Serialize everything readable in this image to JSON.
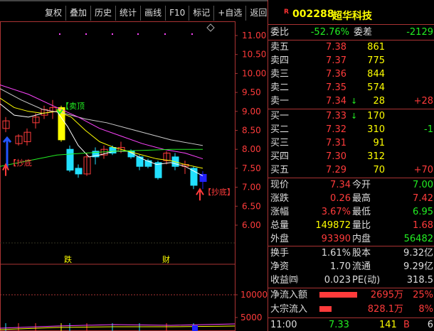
{
  "toolbar": {
    "items": [
      "复权",
      "叠加",
      "历史",
      "统计",
      "画线",
      "F10",
      "标记",
      "+自选",
      "返回"
    ]
  },
  "stock": {
    "badge": "R",
    "code": "002288",
    "name": "超华科技"
  },
  "quote": {
    "weibi_label": "委比",
    "weibi_value": "-52.76%",
    "weicha_label": "委差",
    "weicha_value": "-2129",
    "sells": [
      {
        "label": "卖五",
        "price": "7.38",
        "vol": "861",
        "chg": ""
      },
      {
        "label": "卖四",
        "price": "7.37",
        "vol": "775",
        "chg": ""
      },
      {
        "label": "卖三",
        "price": "7.36",
        "vol": "844",
        "chg": ""
      },
      {
        "label": "卖二",
        "price": "7.35",
        "vol": "574",
        "chg": ""
      },
      {
        "label": "卖一",
        "price": "7.34",
        "vol": "28",
        "chg": "+28"
      }
    ],
    "buys": [
      {
        "label": "买一",
        "price": "7.33",
        "vol": "170",
        "chg": ""
      },
      {
        "label": "买二",
        "price": "7.32",
        "vol": "310",
        "chg": "-1"
      },
      {
        "label": "买三",
        "price": "7.31",
        "vol": "91",
        "chg": ""
      },
      {
        "label": "买四",
        "price": "7.30",
        "vol": "312",
        "chg": ""
      },
      {
        "label": "买五",
        "price": "7.29",
        "vol": "70",
        "chg": "+70"
      }
    ],
    "stats": [
      {
        "l1": "现价",
        "v1": "7.34",
        "c1": "red",
        "l2": "今开",
        "v2": "7.00",
        "c2": "green"
      },
      {
        "l1": "涨跌",
        "v1": "0.26",
        "c1": "red",
        "l2": "最高",
        "v2": "7.42",
        "c2": "red"
      },
      {
        "l1": "涨幅",
        "v1": "3.67%",
        "c1": "red",
        "l2": "最低",
        "v2": "6.95",
        "c2": "green"
      },
      {
        "l1": "总量",
        "v1": "149872",
        "c1": "yel",
        "l2": "量比",
        "v2": "1.68",
        "c2": "red"
      },
      {
        "l1": "外盘",
        "v1": "93390",
        "c1": "red",
        "l2": "内盘",
        "v2": "56482",
        "c2": "green"
      }
    ],
    "stats2": [
      {
        "l1": "换手",
        "v1": "1.61%",
        "l2": "股本",
        "v2": "9.32亿"
      },
      {
        "l1": "净资",
        "v1": "1.70",
        "l2": "流通",
        "v2": "9.29亿"
      },
      {
        "l1": "收益㈣",
        "v1": "0.023",
        "l2": "PE(动)",
        "v2": "318.5"
      }
    ],
    "flows": [
      {
        "label": "净流入额",
        "value": "2695万",
        "pct": "25%",
        "frac": 0.25
      },
      {
        "label": "大宗流入",
        "value": "828.1万",
        "pct": "8%",
        "frac": 0.08
      }
    ],
    "tick": {
      "time": "11:00",
      "price": "7.33",
      "vol": "141",
      "side": "B",
      "num": "6"
    }
  },
  "chart": {
    "price_axis": [
      "11.00",
      "10.50",
      "10.00",
      "9.50",
      "9.00",
      "8.50",
      "8.00",
      "7.50",
      "7.00",
      "6.50",
      "6.00"
    ],
    "vol_axis": [
      "10000",
      "5000"
    ],
    "annotations": {
      "sell_top": "【卖顶",
      "buy_bottom_1": "【抄底",
      "buy_bottom_2": "【抄底】",
      "marker_die": "跌",
      "marker_cai": "财"
    },
    "colors": {
      "up": "#ff3b3b",
      "down": "#22e0ff",
      "ma5": "#ffffff",
      "ma10": "#ffff00",
      "ma20": "#ff44ff",
      "ma60": "#22ee22"
    }
  }
}
